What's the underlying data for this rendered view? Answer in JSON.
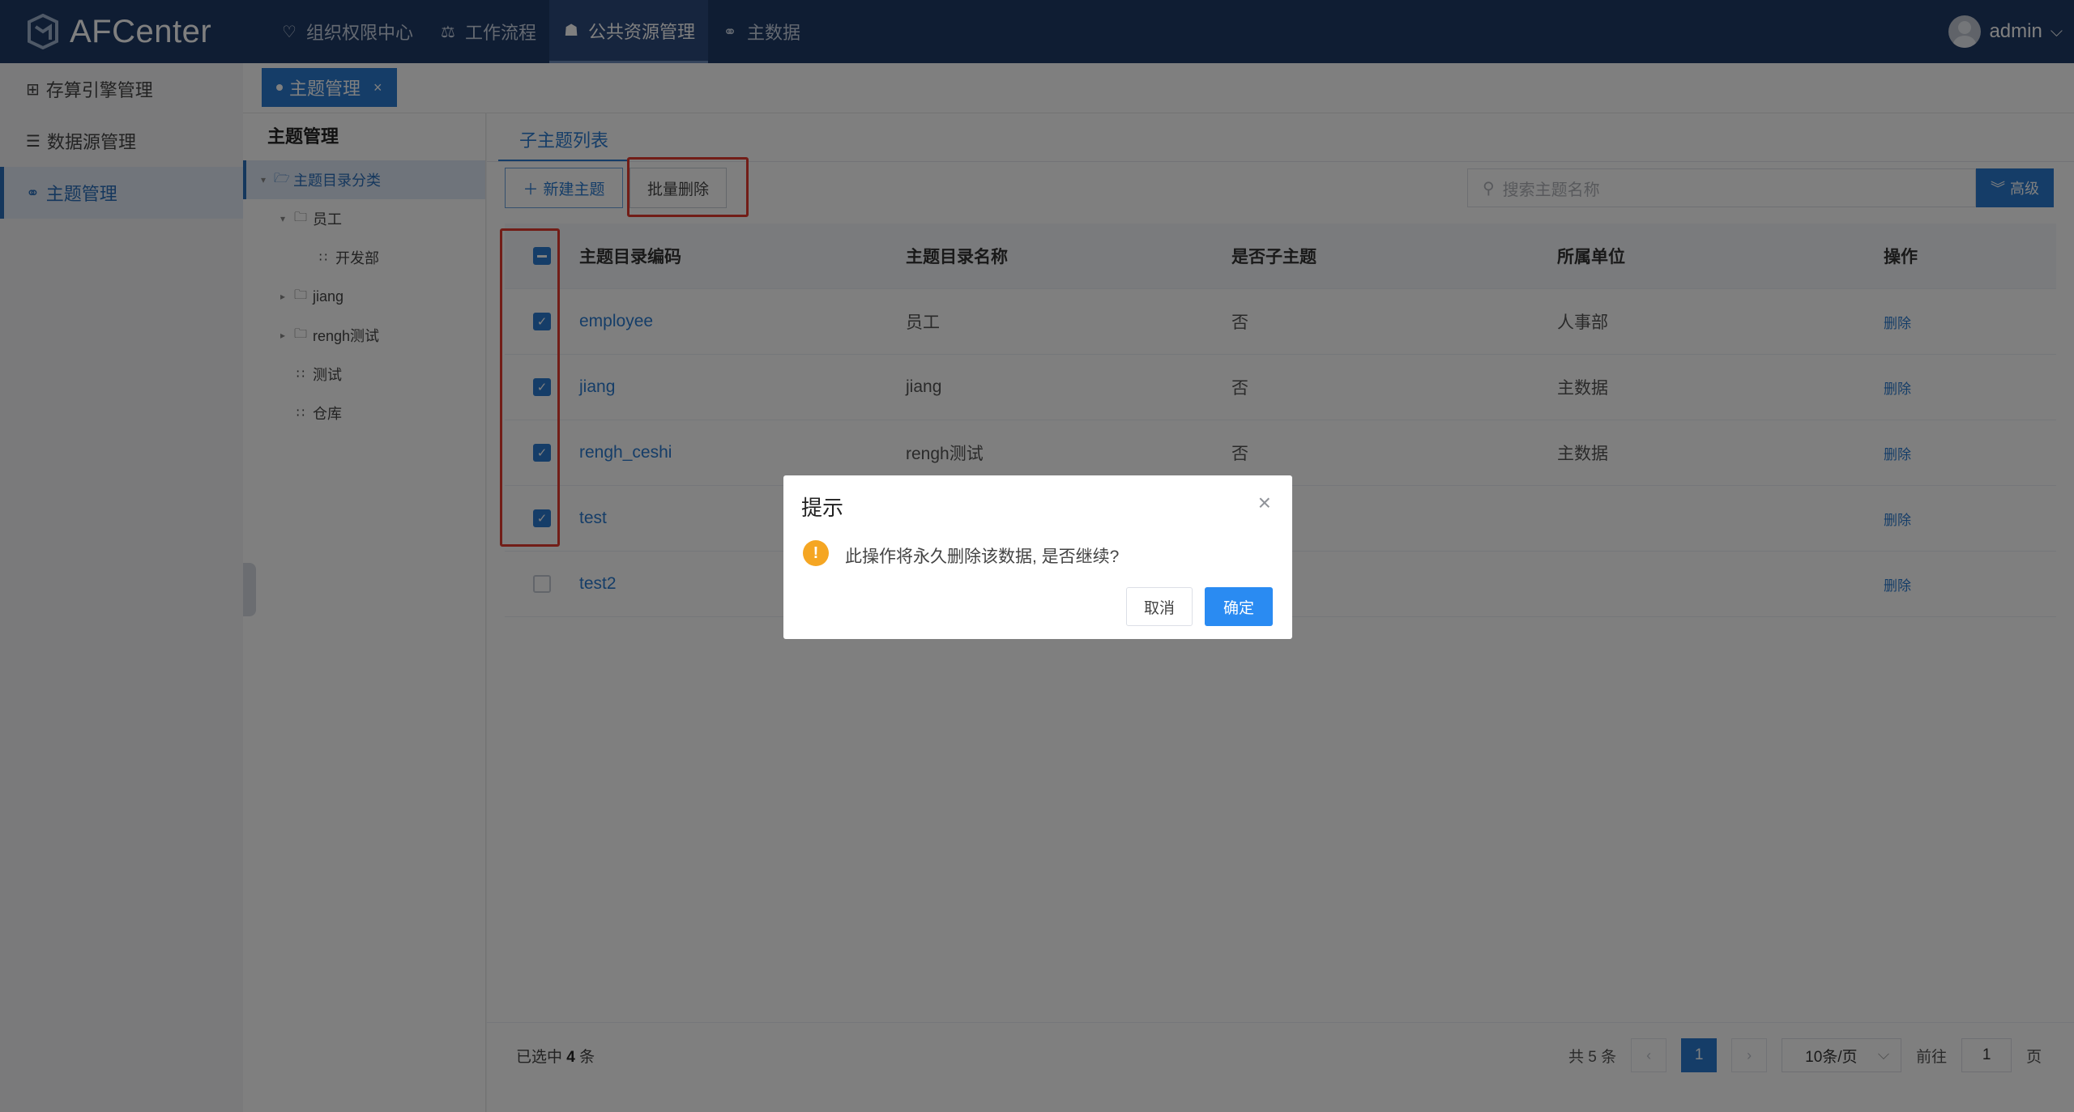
{
  "app": {
    "title": "AFCenter"
  },
  "topnav": [
    {
      "label": "组织权限中心",
      "icon": "shield-icon"
    },
    {
      "label": "工作流程",
      "icon": "flow-icon"
    },
    {
      "label": "公共资源管理",
      "icon": "people-icon",
      "active": true
    },
    {
      "label": "主数据",
      "icon": "data-icon"
    }
  ],
  "user": {
    "name": "admin"
  },
  "sidebar": [
    {
      "label": "存算引擎管理",
      "icon": "grid-icon"
    },
    {
      "label": "数据源管理",
      "icon": "database-icon"
    },
    {
      "label": "主题管理",
      "icon": "data-icon",
      "active": true
    }
  ],
  "tab": {
    "label": "主题管理",
    "close": "×"
  },
  "tree": {
    "title": "主题管理",
    "nodes": [
      {
        "label": "主题目录分类",
        "level": 0,
        "selected": true
      },
      {
        "label": "员工",
        "level": 1
      },
      {
        "label": "开发部",
        "level": 2
      },
      {
        "label": "jiang",
        "level": 1
      },
      {
        "label": "rengh测试",
        "level": 1
      },
      {
        "label": "测试",
        "level": 1
      },
      {
        "label": "仓库",
        "level": 1
      }
    ]
  },
  "main": {
    "subtab": "子主题列表",
    "new_button": "新建主题",
    "batch_delete_button": "批量删除",
    "search_placeholder": "搜索主题名称",
    "advanced_button": "高级"
  },
  "table": {
    "headers": [
      "主题目录编码",
      "主题目录名称",
      "是否子主题",
      "所属单位",
      "操作"
    ],
    "rows": [
      {
        "code": "employee",
        "name": "员工",
        "sub": "否",
        "unit": "人事部",
        "op": "删除",
        "checked": true
      },
      {
        "code": "jiang",
        "name": "jiang",
        "sub": "否",
        "unit": "主数据",
        "op": "删除",
        "checked": true
      },
      {
        "code": "rengh_ceshi",
        "name": "rengh测试",
        "sub": "否",
        "unit": "主数据",
        "op": "删除",
        "checked": true
      },
      {
        "code": "test",
        "name": "",
        "sub": "",
        "unit": "",
        "op": "删除",
        "checked": true
      },
      {
        "code": "test2",
        "name": "",
        "sub": "",
        "unit": "",
        "op": "删除",
        "checked": false
      }
    ]
  },
  "footer": {
    "selected_prefix": "已选中",
    "selected_count": "4",
    "selected_suffix": "条",
    "total": "共 5 条",
    "prev": "‹",
    "page": "1",
    "next": "›",
    "page_size": "10条/页",
    "goto_prefix": "前往",
    "goto_value": "1",
    "goto_suffix": "页"
  },
  "dialog": {
    "title": "提示",
    "message": "此操作将永久删除该数据, 是否继续?",
    "cancel": "取消",
    "confirm": "确定",
    "close": "×",
    "icon_glyph": "!"
  },
  "colors": {
    "topbar": "#1f3a66",
    "accent": "#2a7bd0",
    "highlight": "#e53b2e",
    "warning": "#f5a623"
  }
}
